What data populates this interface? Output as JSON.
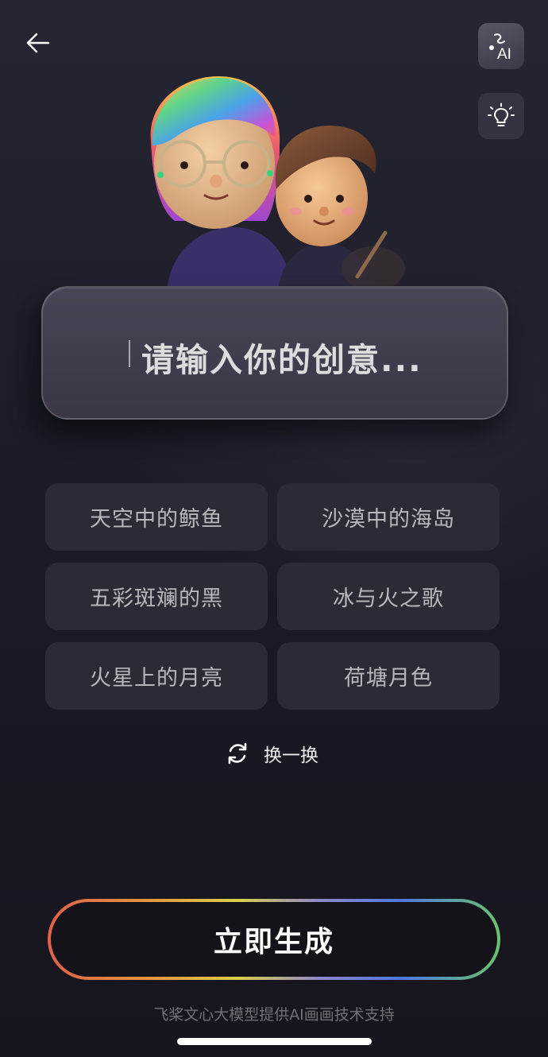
{
  "header": {
    "back_icon": "arrow-left-icon",
    "ai_button_icon": "ai-draw-icon",
    "ai_button_label": "AI",
    "tips_button_icon": "lightbulb-icon"
  },
  "hero": {
    "image": "two-3d-cartoon-artists-illustration"
  },
  "prompt": {
    "placeholder": "请输入你的创意..."
  },
  "suggestions": [
    "天空中的鲸鱼",
    "沙漠中的海岛",
    "五彩斑斓的黑",
    "冰与火之歌",
    "火星上的月亮",
    "荷塘月色"
  ],
  "refresh": {
    "icon": "refresh-icon",
    "label": "换一换"
  },
  "generate": {
    "label": "立即生成"
  },
  "footer": {
    "note": "飞桨文心大模型提供AI画画技术支持"
  },
  "colors": {
    "background": "#1c1b26",
    "chip": "#2c2b35",
    "gradient": [
      "#e2604a",
      "#e4953e",
      "#d9cf4a",
      "#8f87c9",
      "#4f77e0",
      "#69c46e"
    ]
  }
}
